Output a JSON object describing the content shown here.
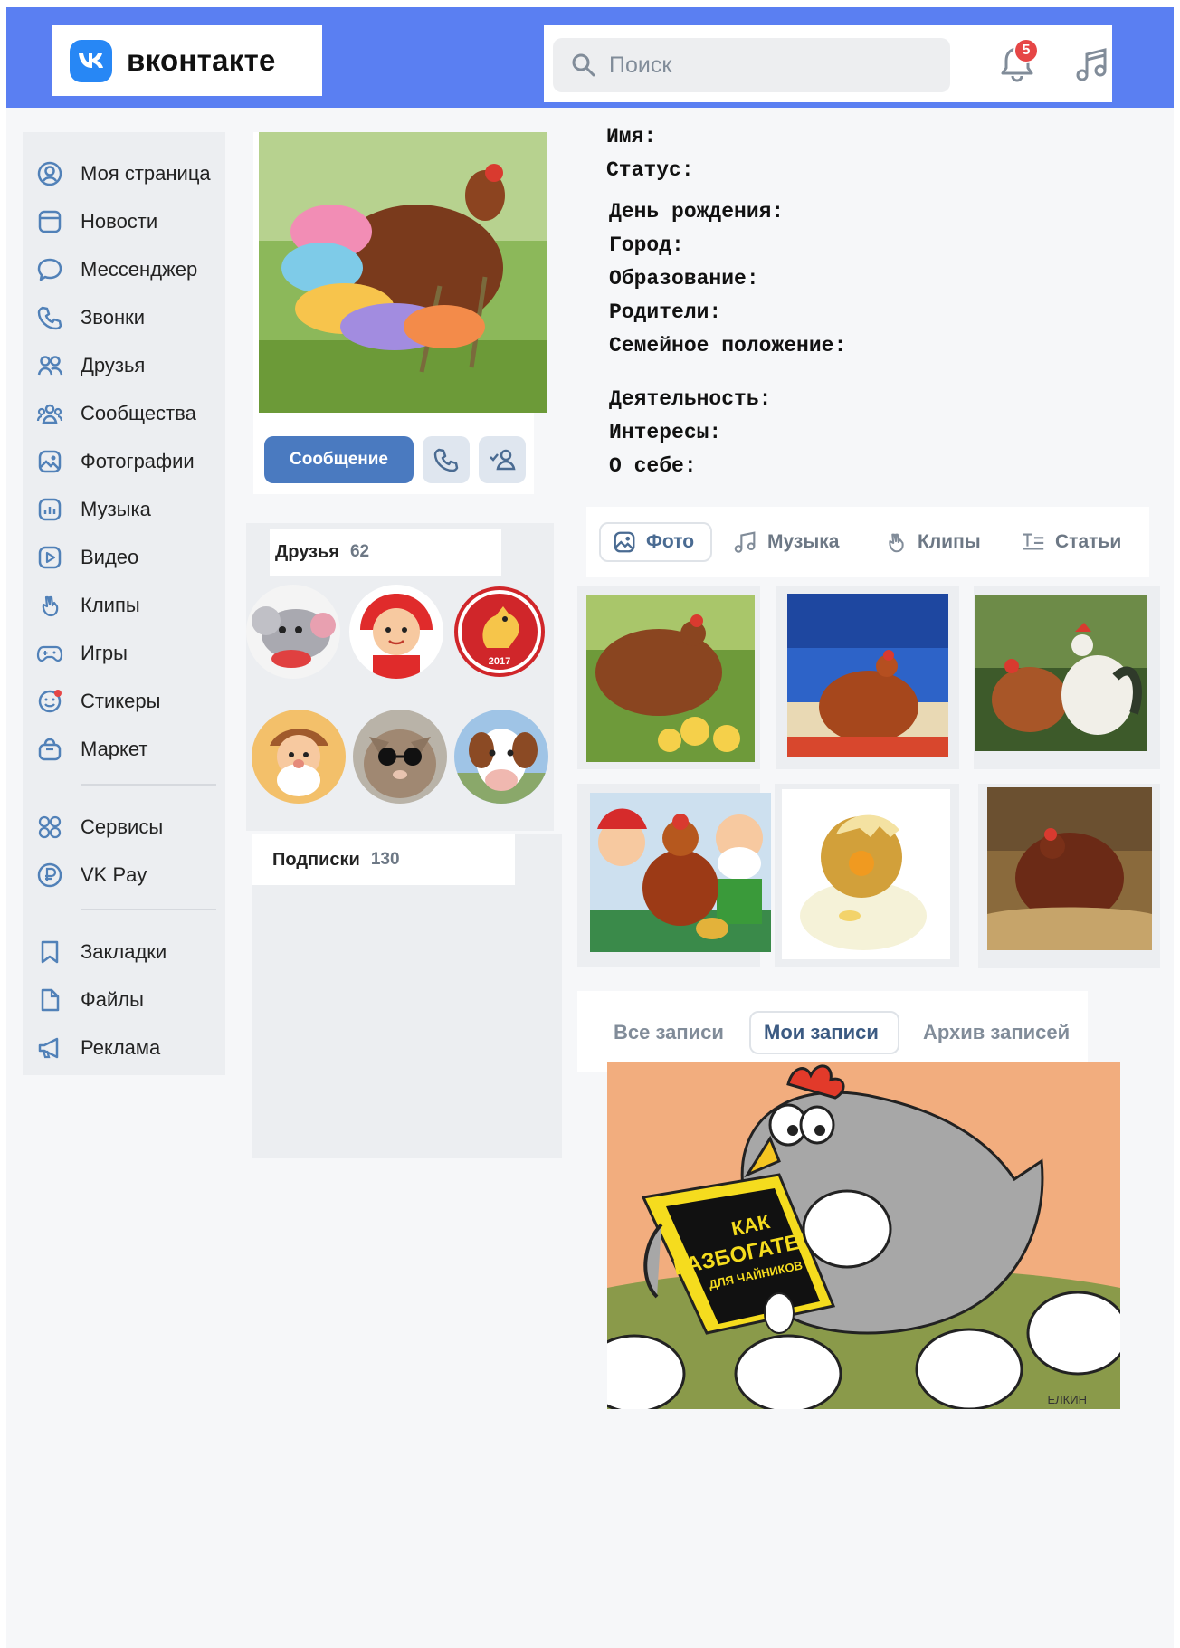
{
  "header": {
    "logo_text": "вконтакте",
    "logo_mark": "vk",
    "search_placeholder": "Поиск",
    "notifications_count": "5",
    "brand_color": "#5a7ff2"
  },
  "sidebar": {
    "items": [
      {
        "label": "Моя страница",
        "icon": "user-circle-icon"
      },
      {
        "label": "Новости",
        "icon": "news-icon"
      },
      {
        "label": "Мессенджер",
        "icon": "message-icon"
      },
      {
        "label": "Звонки",
        "icon": "phone-icon"
      },
      {
        "label": "Друзья",
        "icon": "friends-icon"
      },
      {
        "label": "Сообщества",
        "icon": "communities-icon"
      },
      {
        "label": "Фотографии",
        "icon": "photo-icon"
      },
      {
        "label": "Музыка",
        "icon": "music-icon"
      },
      {
        "label": "Видео",
        "icon": "video-icon"
      },
      {
        "label": "Клипы",
        "icon": "clips-icon"
      },
      {
        "label": "Игры",
        "icon": "gamepad-icon"
      },
      {
        "label": "Стикеры",
        "icon": "sticker-icon"
      },
      {
        "label": "Маркет",
        "icon": "market-bag-icon"
      },
      {
        "label": "Сервисы",
        "icon": "services-grid-icon"
      },
      {
        "label": "VK Pay",
        "icon": "vkpay-ruble-icon"
      },
      {
        "label": "Закладки",
        "icon": "bookmark-icon"
      },
      {
        "label": "Файлы",
        "icon": "file-icon"
      },
      {
        "label": "Реклама",
        "icon": "megaphone-icon"
      }
    ]
  },
  "profile": {
    "message_button": "Сообщение",
    "call_icon": "phone-icon",
    "add_friend_icon": "add-friend-icon"
  },
  "friends": {
    "title": "Друзья",
    "count": "62"
  },
  "subscriptions": {
    "title": "Подписки",
    "count": "130"
  },
  "info_fields": {
    "name": "Имя:",
    "status": "Статус:",
    "birthday": "День рождения:",
    "city": "Город:",
    "education": "Образование:",
    "parents": "Родители:",
    "family": "Семейное положение:",
    "activity": "Деятельность:",
    "interests": "Интересы:",
    "about": "О себе:"
  },
  "media_tabs": [
    {
      "label": "Фото",
      "icon": "photo-icon",
      "active": true
    },
    {
      "label": "Музыка",
      "icon": "music-icon",
      "active": false
    },
    {
      "label": "Клипы",
      "icon": "clips-icon",
      "active": false
    },
    {
      "label": "Статьи",
      "icon": "articles-icon",
      "active": false
    }
  ],
  "post_tabs": [
    {
      "label": "Все записи",
      "active": false
    },
    {
      "label": "Мои записи",
      "active": true
    },
    {
      "label": "Архив записей",
      "active": false
    }
  ],
  "post": {
    "book_line1": "КАК",
    "book_line2": "РАЗБОГАТЕТЬ",
    "book_line3": "ДЛЯ ЧАЙНИКОВ",
    "signature": "ЕЛКИН"
  },
  "friend_badge": "2017"
}
